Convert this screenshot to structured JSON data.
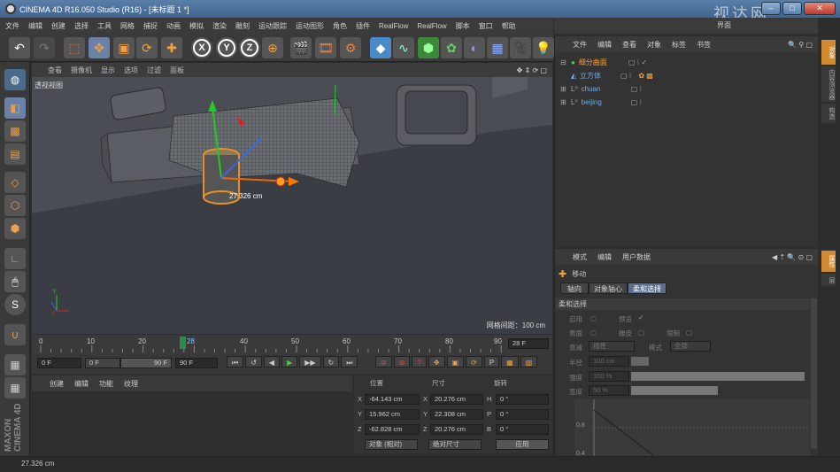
{
  "window": {
    "title": "CINEMA 4D R16.050 Studio (R16) - [未标题 1 *]",
    "watermark": "视达网",
    "btn_min": "–",
    "btn_max": "□",
    "btn_close": "✕"
  },
  "menubar": [
    "文件",
    "编辑",
    "创建",
    "选择",
    "工具",
    "网格",
    "捕捉",
    "动画",
    "模拟",
    "渲染",
    "雕刻",
    "运动跟踪",
    "运动图形",
    "角色",
    "插件",
    "RealFlow",
    "RealFlow",
    "脚本",
    "窗口",
    "帮助"
  ],
  "menubar_right": "界面",
  "toolbar": {
    "axis_x": "X",
    "axis_y": "Y",
    "axis_z": "Z"
  },
  "viewport": {
    "menu": [
      "查看",
      "摄像机",
      "显示",
      "选项",
      "过滤",
      "面板"
    ],
    "label": "透视视图",
    "grid_info": "网格间距：100 cm",
    "measure": "27.326 cm"
  },
  "timeline": {
    "ticks": [
      "0",
      "10",
      "20",
      "28",
      "30",
      "40",
      "50",
      "60",
      "70",
      "80",
      "90"
    ],
    "current": "28",
    "frame_field": "28 F"
  },
  "transport": {
    "start": "0 F",
    "start2": "0 F",
    "end_slider": "90 F",
    "end": "90 F"
  },
  "material": {
    "menu": [
      "创建",
      "编辑",
      "功能",
      "纹理"
    ]
  },
  "coords": {
    "headers": {
      "position": "位置",
      "size": "尺寸",
      "rotation": "旋转"
    },
    "rows": [
      {
        "axis": "X",
        "pos": "-64.143 cm",
        "size_axis": "X",
        "size": "20.276 cm",
        "rot_axis": "H",
        "rot": "0 °"
      },
      {
        "axis": "Y",
        "pos": "15.962 cm",
        "size_axis": "Y",
        "size": "22.308 cm",
        "rot_axis": "P",
        "rot": "0 °"
      },
      {
        "axis": "Z",
        "pos": "-62.828 cm",
        "size_axis": "Z",
        "size": "20.276 cm",
        "rot_axis": "B",
        "rot": "0 °"
      }
    ],
    "mode": "对象 (相对)",
    "size_mode": "绝对尺寸",
    "apply": "应用"
  },
  "objects": {
    "menu": [
      "文件",
      "编辑",
      "查看",
      "对象",
      "标签",
      "书签"
    ],
    "items": [
      {
        "name": "细分曲面",
        "selected": true
      },
      {
        "name": "立方体",
        "selected": false
      },
      {
        "name": "chuan",
        "selected": false
      },
      {
        "name": "beijing",
        "selected": false
      }
    ]
  },
  "attributes": {
    "menu": [
      "模式",
      "编辑",
      "用户数据"
    ],
    "tool_name": "移动",
    "tabs": [
      "轴向",
      "对象轴心",
      "柔和选择"
    ],
    "section": "柔和选择",
    "fields": {
      "enable": "启用",
      "preview": "预览",
      "surface": "表面",
      "rubber": "橡皮",
      "restrict": "限制",
      "type_label": "衰减",
      "type_value": "线性",
      "mode_label": "模式",
      "mode_value": "全部",
      "radius_label": "半径",
      "radius_value": "100 cm",
      "strength_label": "强度",
      "strength_value": "100 %",
      "width_label": "宽度",
      "width_value": "50 %"
    },
    "graph_ticks": [
      "0.8",
      "0.4"
    ]
  },
  "right_tabs": [
    "对象",
    "内容浏览器",
    "构造",
    "属性",
    "层"
  ],
  "status": "27.326 cm",
  "brand": "MAXON CINEMA 4D"
}
